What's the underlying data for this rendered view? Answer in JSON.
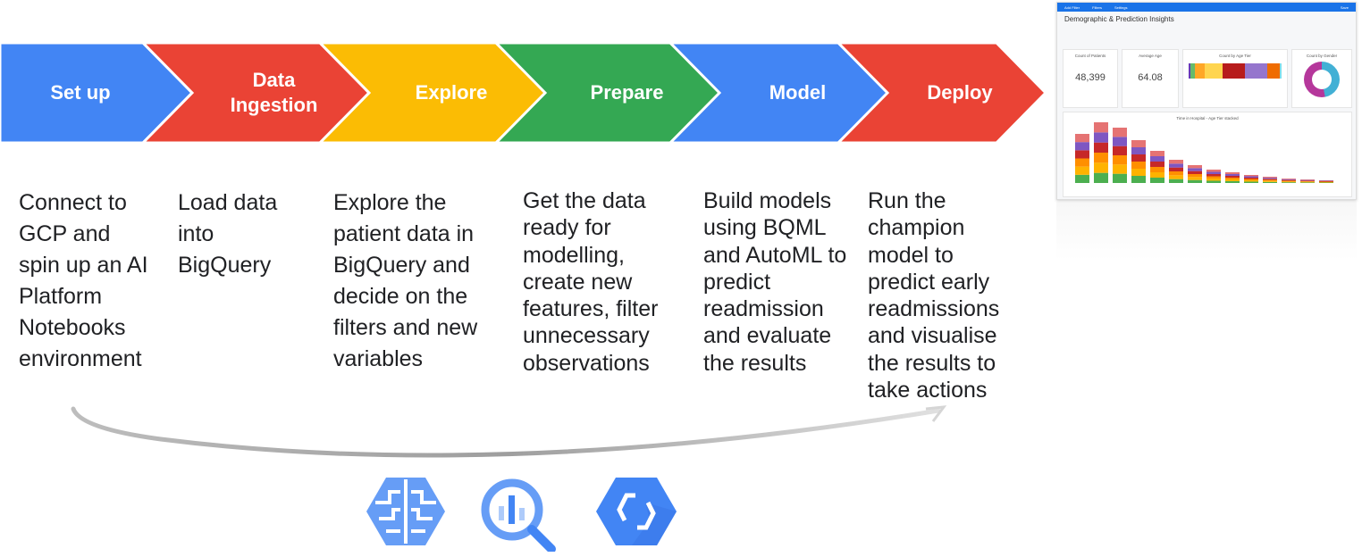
{
  "stages": [
    {
      "label": "Set up",
      "color": "#4285f4",
      "description": [
        "Connect to",
        "GCP and",
        "spin up an AI",
        "Platform",
        "Notebooks",
        "environment"
      ]
    },
    {
      "label": "Data Ingestion",
      "color": "#ea4335",
      "description": [
        "Load data",
        "into",
        "BigQuery"
      ]
    },
    {
      "label": "Explore",
      "color": "#fbbc04",
      "description": [
        "Explore the",
        "patient data in",
        "BigQuery and",
        "decide on the",
        "filters and new",
        "variables"
      ]
    },
    {
      "label": "Prepare",
      "color": "#34a853",
      "description": [
        "Get the data",
        "ready for",
        "modelling,",
        "create new",
        "features, filter",
        "unnecessary",
        "observations"
      ]
    },
    {
      "label": "Model",
      "color": "#4285f4",
      "description": [
        "Build models",
        "using BQML",
        "and AutoML to",
        "predict",
        "readmission",
        "and evaluate",
        "the results"
      ]
    },
    {
      "label": "Deploy",
      "color": "#ea4335",
      "description": [
        "Run the",
        "champion",
        "model to",
        "predict early",
        "readmissions",
        "and visualise",
        "the results to",
        "take actions"
      ]
    }
  ],
  "dashboard": {
    "toolbar": [
      "Add Filter",
      "Filters",
      "Settings"
    ],
    "save": "Save",
    "title": "Demographic & Prediction Insights",
    "cards": [
      {
        "title": "Count of Patients",
        "value": "48,399"
      },
      {
        "title": "Average Age",
        "value": "64.08"
      },
      {
        "title": "Count by Age Tier"
      },
      {
        "title": "Count by Gender"
      }
    ],
    "chart_title": "Time in Hospital - Age Tier stacked"
  },
  "icons": [
    "ai-platform-icon",
    "bigquery-icon",
    "cloud-composer-icon"
  ],
  "colors": {
    "blue": "#4285f4",
    "red": "#ea4335",
    "yellow": "#fbbc04",
    "green": "#34a853"
  }
}
